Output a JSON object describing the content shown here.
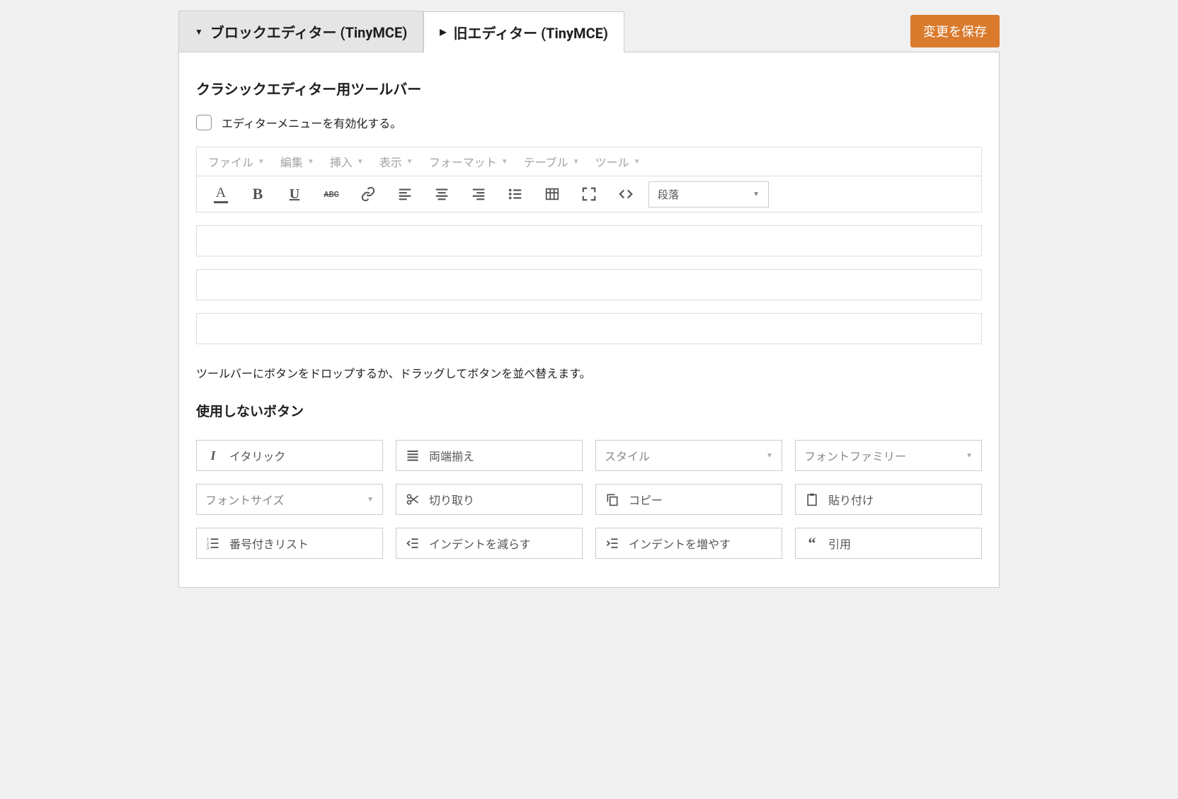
{
  "tabs": {
    "block": "ブロックエディター (TinyMCE)",
    "classic": "旧エディター (TinyMCE)"
  },
  "save_button": "変更を保存",
  "section": {
    "title": "クラシックエディター用ツールバー",
    "enable_menu_label": "エディターメニューを有効化する。"
  },
  "menubar": {
    "file": "ファイル",
    "edit": "編集",
    "insert": "挿入",
    "view": "表示",
    "format": "フォーマット",
    "table": "テーブル",
    "tools": "ツール"
  },
  "toolbar": {
    "text_color": "A",
    "bold": "B",
    "underline": "U",
    "strike": "ABC",
    "format_select": "段落"
  },
  "helper_text": "ツールバーにボタンをドロップするか、ドラッグしてボタンを並べ替えます。",
  "unused_title": "使用しないボタン",
  "unused": {
    "italic": "イタリック",
    "justify": "両端揃え",
    "style": "スタイル",
    "font_family": "フォントファミリー",
    "font_size": "フォントサイズ",
    "cut": "切り取り",
    "copy": "コピー",
    "paste": "貼り付け",
    "ol": "番号付きリスト",
    "outdent": "インデントを減らす",
    "indent": "インデントを増やす",
    "blockquote": "引用"
  }
}
